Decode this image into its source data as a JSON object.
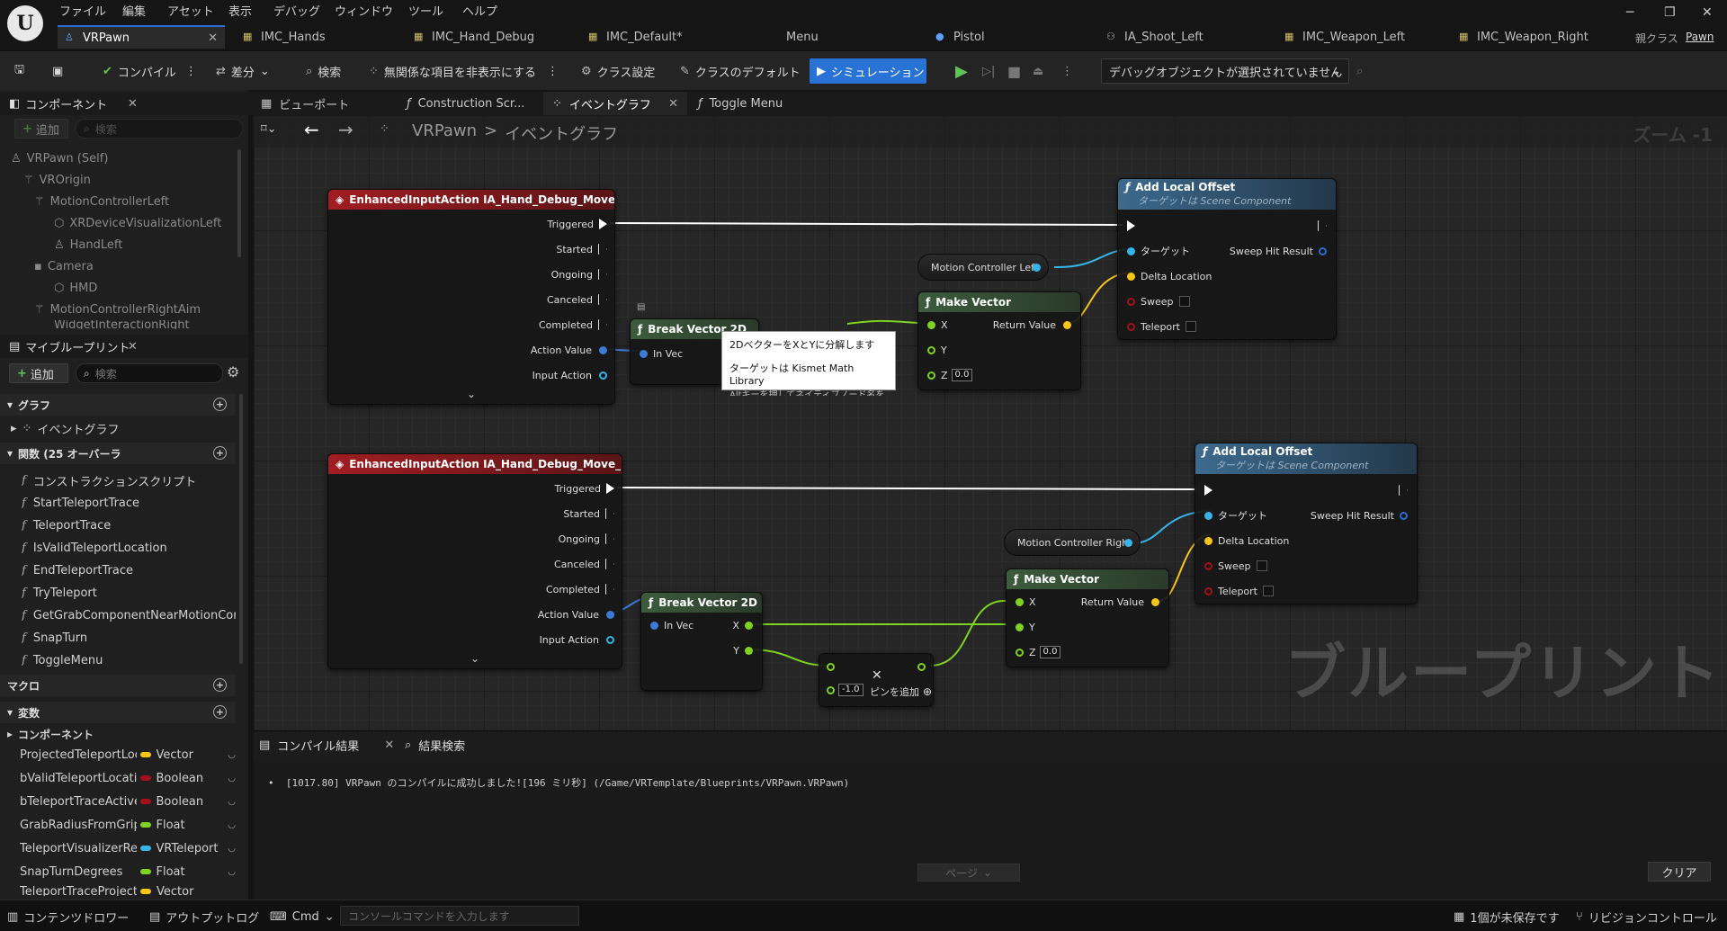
{
  "menu": [
    "ファイル",
    "編集",
    "アセット",
    "表示",
    "デバッグ",
    "ウィンドウ",
    "ツール",
    "ヘルプ"
  ],
  "doc_tabs": [
    {
      "label": "VRPawn",
      "active": true
    },
    {
      "label": "IMC_Hands"
    },
    {
      "label": "IMC_Hand_Debug"
    },
    {
      "label": "IMC_Default*"
    },
    {
      "label": "Menu"
    },
    {
      "label": "Pistol"
    },
    {
      "label": "IA_Shoot_Left"
    },
    {
      "label": "IMC_Weapon_Left"
    },
    {
      "label": "IMC_Weapon_Right"
    }
  ],
  "parent_class": {
    "label": "親クラス",
    "value": "Pawn"
  },
  "toolbar": {
    "compile": "コンパイル",
    "diff": "差分",
    "search": "検索",
    "hide": "無関係な項目を非表示にする",
    "class_settings": "クラス設定",
    "class_defaults": "クラスのデフォルト",
    "simulation": "シミュレーション",
    "debug_object": "デバッグオブジェクトが選択されていません"
  },
  "components_panel": {
    "title": "コンポーネント",
    "add": "追加",
    "search_placeholder": "検索",
    "tree": [
      "VRPawn (Self)",
      "VROrigin",
      "MotionControllerLeft",
      "XRDeviceVisualizationLeft",
      "HandLeft",
      "Camera",
      "HMD",
      "MotionControllerRightAim",
      "WidgetInteractionRight"
    ]
  },
  "my_blueprint": {
    "title": "マイブループリント",
    "add": "追加",
    "search_placeholder": "検索",
    "graphs_cat": "グラフ",
    "event_graph": "イベントグラフ",
    "functions_cat": "関数 (25 オーバーラ",
    "functions": [
      "コンストラクションスクリプト",
      "StartTeleportTrace",
      "TeleportTrace",
      "IsValidTeleportLocation",
      "EndTeleportTrace",
      "TryTeleport",
      "GetGrabComponentNearMotionController",
      "SnapTurn",
      "ToggleMenu"
    ],
    "macros_cat": "マクロ",
    "variables_cat": "変数",
    "components_sub": "コンポーネント",
    "variables": [
      {
        "name": "ProjectedTeleportLocation",
        "type": "Vector",
        "color": "#f5c518"
      },
      {
        "name": "bValidTeleportLocation",
        "type": "Boolean",
        "color": "#a3101a"
      },
      {
        "name": "bTeleportTraceActive",
        "type": "Boolean",
        "color": "#a3101a"
      },
      {
        "name": "GrabRadiusFromGripPosition",
        "type": "Float",
        "color": "#7ed321"
      },
      {
        "name": "TeleportVisualizerReference",
        "type": "VRTeleportVisualizer",
        "color": "#36b3e8"
      },
      {
        "name": "SnapTurnDegrees",
        "type": "Float",
        "color": "#7ed321"
      },
      {
        "name": "TeleportTraceProjectilePath",
        "type": "Vector",
        "color": "#f5c518"
      }
    ]
  },
  "graph_tabs": [
    {
      "label": "ビューポート"
    },
    {
      "label": "Construction Scr..."
    },
    {
      "label": "イベントグラフ",
      "active": true
    },
    {
      "label": "Toggle Menu"
    }
  ],
  "breadcrumb": {
    "root": "VRPawn",
    "sep": ">",
    "current": "イベントグラフ",
    "zoom": "ズーム -1"
  },
  "nodes": {
    "event_left": {
      "title": "EnhancedInputAction IA_Hand_Debug_Move_Left",
      "pins": [
        "Triggered",
        "Started",
        "Ongoing",
        "Canceled",
        "Completed",
        "Action Value",
        "Input Action"
      ]
    },
    "event_right": {
      "title": "EnhancedInputAction IA_Hand_Debug_Move_Right",
      "pins": [
        "Triggered",
        "Started",
        "Ongoing",
        "Canceled",
        "Completed",
        "Action Value",
        "Input Action"
      ]
    },
    "break_left": {
      "title": "Break Vector 2D",
      "in": "In Vec"
    },
    "break_right": {
      "title": "Break Vector 2D",
      "in": "In Vec",
      "x": "X",
      "y": "Y"
    },
    "make_left": {
      "title": "Make Vector",
      "x": "X",
      "y": "Y",
      "z": "Z",
      "z_val": "0.0",
      "ret": "Return Value"
    },
    "make_right": {
      "title": "Make Vector",
      "x": "X",
      "y": "Y",
      "z": "Z",
      "z_val": "0.0",
      "ret": "Return Value"
    },
    "alo_left": {
      "title": "Add Local Offset",
      "sub": "ターゲットは Scene Component",
      "target": "ターゲット",
      "hit": "Sweep Hit Result",
      "delta": "Delta Location",
      "sweep": "Sweep",
      "teleport": "Teleport"
    },
    "alo_right": {
      "title": "Add Local Offset",
      "sub": "ターゲットは Scene Component",
      "target": "ターゲット",
      "hit": "Sweep Hit Result",
      "delta": "Delta Location",
      "sweep": "Sweep",
      "teleport": "Teleport"
    },
    "mc_left": "Motion Controller Left",
    "mc_right": "Motion Controller Right",
    "multiply": {
      "val": "-1.0",
      "add_pin": "ピンを追加"
    }
  },
  "tooltip": {
    "line1": "2DベクターをXとYに分解します",
    "line2": "ターゲットは Kismet Math Library",
    "line3": "Altキーを押してネイティブノード名を表示"
  },
  "watermark": "ブループリント",
  "compile": {
    "tab": "コンパイル結果",
    "find": "結果検索",
    "message": "[1017.80] VRPawn のコンパイルに成功しました![196 ミリ秒] (/Game/VRTemplate/Blueprints/VRPawn.VRPawn)",
    "page": "ページ",
    "clear": "クリア"
  },
  "status": {
    "content_drawer": "コンテンツドロワー",
    "output_log": "アウトプットログ",
    "cmd": "Cmd",
    "console_placeholder": "コンソールコマンドを入力します",
    "unsaved": "1個が未保存です",
    "revision": "リビジョンコントロール"
  }
}
